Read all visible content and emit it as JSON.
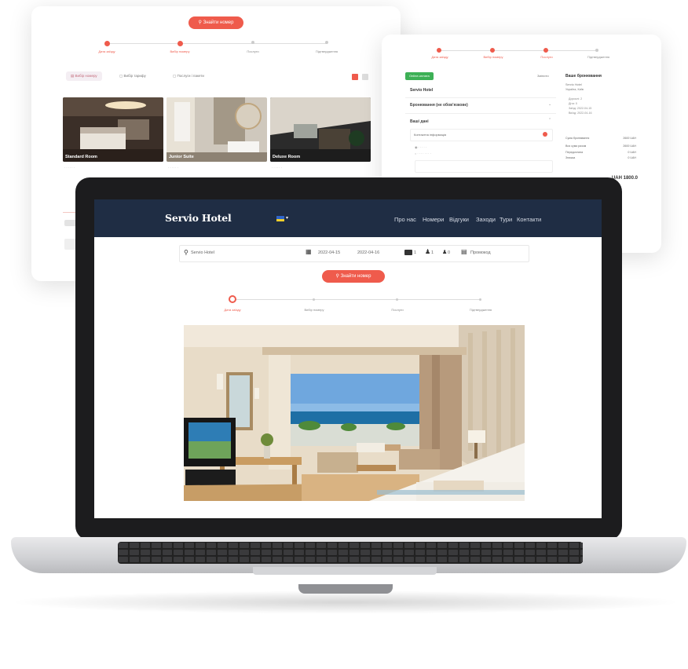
{
  "back_left": {
    "search_label": "Знайти номер",
    "steps": [
      "Дата заїзду",
      "Вибір номеру",
      "Послуги",
      "Підтвердження"
    ],
    "tabs": [
      "Вибір номеру",
      "Вибір тарифу",
      "Послуги і пакети"
    ],
    "rooms": [
      {
        "name": "Standard Room"
      },
      {
        "name": "Junior Suite"
      },
      {
        "name": "Deluxe Room"
      }
    ]
  },
  "back_right": {
    "steps": [
      "Дата заїзду",
      "Вибір номеру",
      "Послуги",
      "Підтвердження"
    ],
    "badge": "Online-оплата",
    "link": "Змінити",
    "hotel_name": "Servio Hotel",
    "section1": "Бронювання (не обов'язкове)",
    "section2": "Ваші дані",
    "field": "Контактна інформація",
    "summary_title": "Ваше бронювання",
    "summary_lines": [
      "Servio Hotel",
      "Україна, Київ",
      "Дорослі: 2",
      "Діти: 0",
      "Заїзд: 2022-04-15",
      "Виїзд: 2022-04-16"
    ],
    "price_rows": [
      {
        "label": "Сума бронювання",
        "value": "2600 UAH"
      },
      {
        "label": "Вся сума разом",
        "value": "2600 UAH"
      },
      {
        "label": "Передоплата",
        "value": "0 UAH"
      },
      {
        "label": "Знижка",
        "value": "0 UAH"
      }
    ],
    "total": "UAH 1800.0"
  },
  "laptop": {
    "logo": "Servio Hotel",
    "nav": [
      "Про нас",
      "Номери",
      "Відгуки",
      "Заходи",
      "Тури",
      "Контакти"
    ],
    "search": {
      "location": "Servio Hotel",
      "date_in": "2022-04-15",
      "date_out": "2022-04-16",
      "rooms": "1",
      "adults": "1",
      "children": "0",
      "promo": "Промокод"
    },
    "search_button": "Знайти номер",
    "steps": [
      "Дата заїзду",
      "Вибір номеру",
      "Послуги",
      "Підтвердження"
    ],
    "active_step": 0
  },
  "colors": {
    "accent": "#ef5b4c",
    "navbar": "#1f2d44"
  }
}
